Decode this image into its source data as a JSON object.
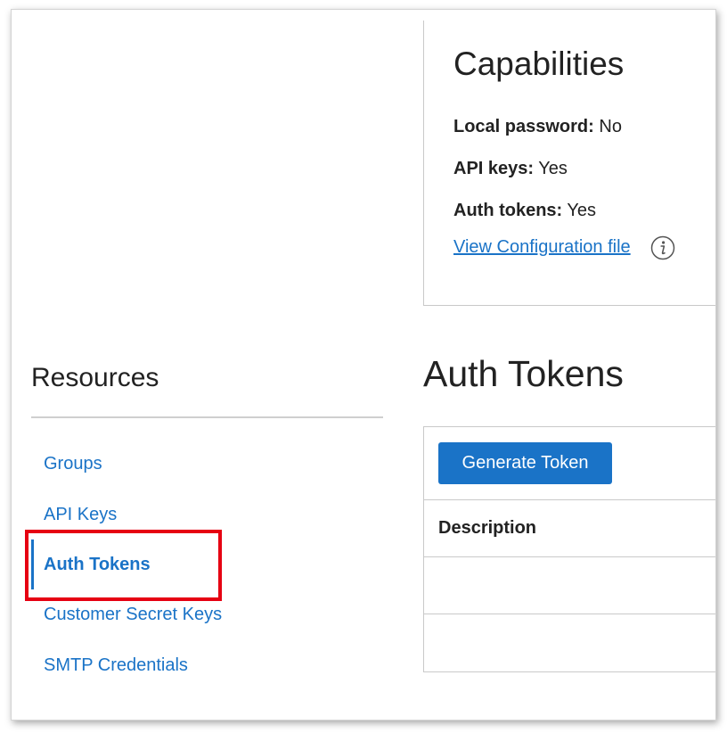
{
  "capabilities": {
    "title": "Capabilities",
    "rows": [
      {
        "label": "Local password:",
        "value": "No"
      },
      {
        "label": "API keys:",
        "value": "Yes"
      },
      {
        "label": "Auth tokens:",
        "value": "Yes"
      }
    ],
    "config_link": "View Configuration file"
  },
  "resources": {
    "title": "Resources",
    "items": [
      {
        "label": "Groups"
      },
      {
        "label": "API Keys"
      },
      {
        "label": "Auth Tokens",
        "active": true
      },
      {
        "label": "Customer Secret Keys"
      },
      {
        "label": "SMTP Credentials"
      }
    ]
  },
  "auth_tokens": {
    "title": "Auth Tokens",
    "generate_button": "Generate Token",
    "columns": [
      "Description"
    ]
  },
  "colors": {
    "link": "#1a73c7",
    "button": "#1a73c7",
    "highlight": "#e60012",
    "text": "#222222"
  }
}
